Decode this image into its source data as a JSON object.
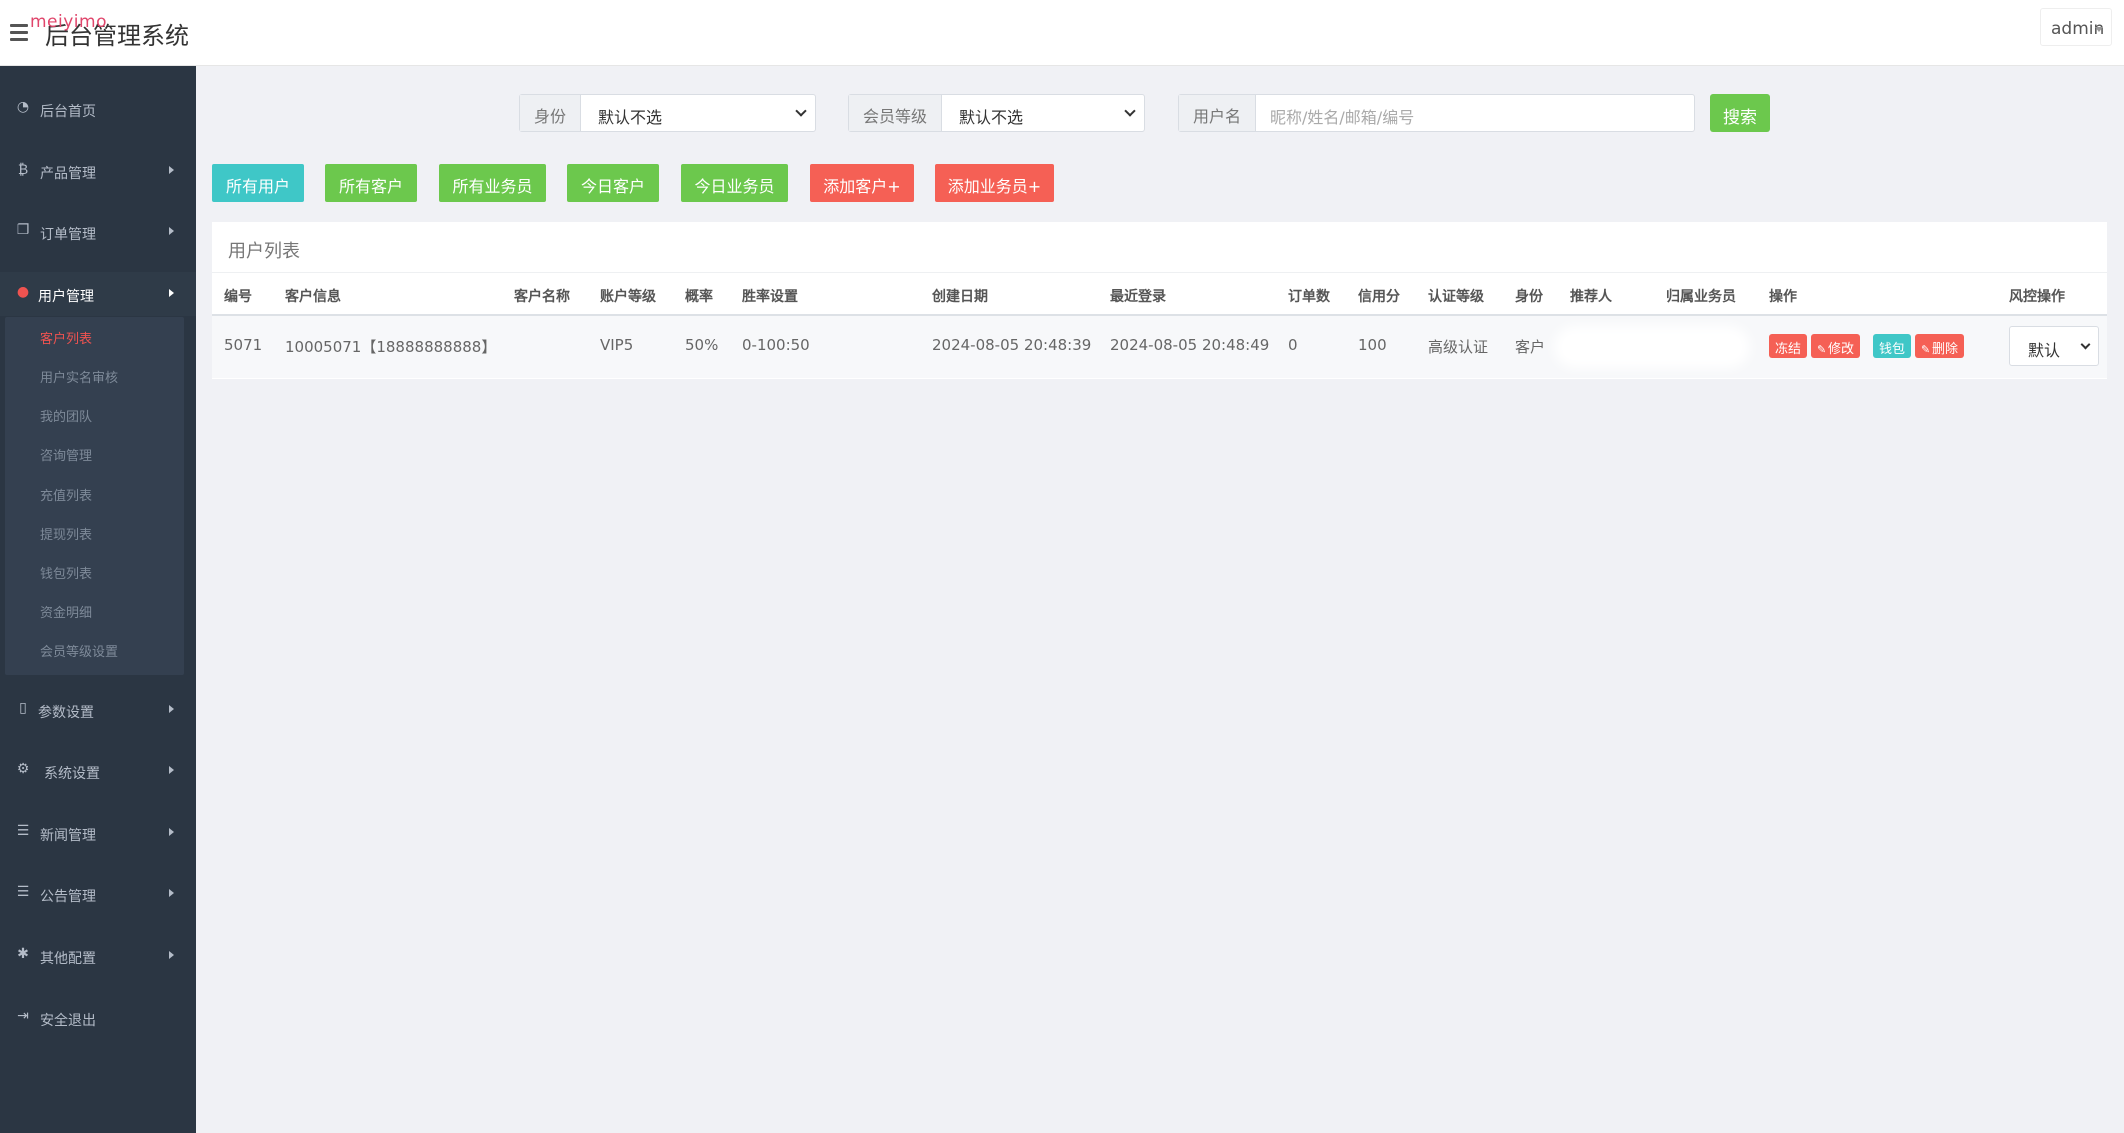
{
  "header": {
    "brand_overlay": "meiyimo",
    "title": "后台管理系统",
    "user": "admin"
  },
  "sidebar": {
    "items": [
      {
        "label": "后台首页",
        "icon": "dashboard-icon"
      },
      {
        "label": "产品管理",
        "icon": "bitcoin-icon"
      },
      {
        "label": "订单管理",
        "icon": "copy-icon"
      },
      {
        "label": "用户管理",
        "icon": "user-icon"
      },
      {
        "label": "参数设置",
        "icon": "file-icon"
      },
      {
        "label": "系统设置",
        "icon": "gears-icon"
      },
      {
        "label": "新闻管理",
        "icon": "list-icon"
      },
      {
        "label": "公告管理",
        "icon": "list-icon"
      },
      {
        "label": "其他配置",
        "icon": "gear-icon"
      },
      {
        "label": "安全退出",
        "icon": "signout-icon"
      }
    ],
    "submenu": [
      "客户列表",
      "用户实名审核",
      "我的团队",
      "咨询管理",
      "充值列表",
      "提现列表",
      "钱包列表",
      "资金明细",
      "会员等级设置"
    ]
  },
  "filters": {
    "identity_label": "身份",
    "identity_value": "默认不选",
    "level_label": "会员等级",
    "level_value": "默认不选",
    "username_label": "用户名",
    "username_placeholder": "昵称/姓名/邮箱/编号",
    "search_label": "搜索"
  },
  "quick_buttons": [
    "所有用户",
    "所有客户",
    "所有业务员",
    "今日客户",
    "今日业务员",
    "添加客户+",
    "添加业务员+"
  ],
  "table": {
    "title": "用户列表",
    "headers": [
      "编号",
      "客户信息",
      "客户名称",
      "账户等级",
      "概率",
      "胜率设置",
      "创建日期",
      "最近登录",
      "订单数",
      "信用分",
      "认证等级",
      "身份",
      "推荐人",
      "归属业务员",
      "操作",
      "风控操作"
    ],
    "rows": [
      {
        "id": "5071",
        "info": "10005071【18888888888】",
        "name": "",
        "level": "VIP5",
        "prob": "50%",
        "win_setting": "0-100:50",
        "created": "2024-08-05 20:48:39",
        "last_login": "2024-08-05 20:48:49",
        "orders": "0",
        "credit": "100",
        "auth_level": "高级认证",
        "identity": "客户",
        "actions": [
          "冻结",
          "修改",
          "钱包",
          "删除"
        ],
        "risk": "默认"
      }
    ]
  },
  "colors": {
    "sidebar_bg": "#2b3643",
    "accent_red": "#f56055",
    "accent_green": "#6cc84d",
    "accent_teal": "#3fc7c7"
  }
}
